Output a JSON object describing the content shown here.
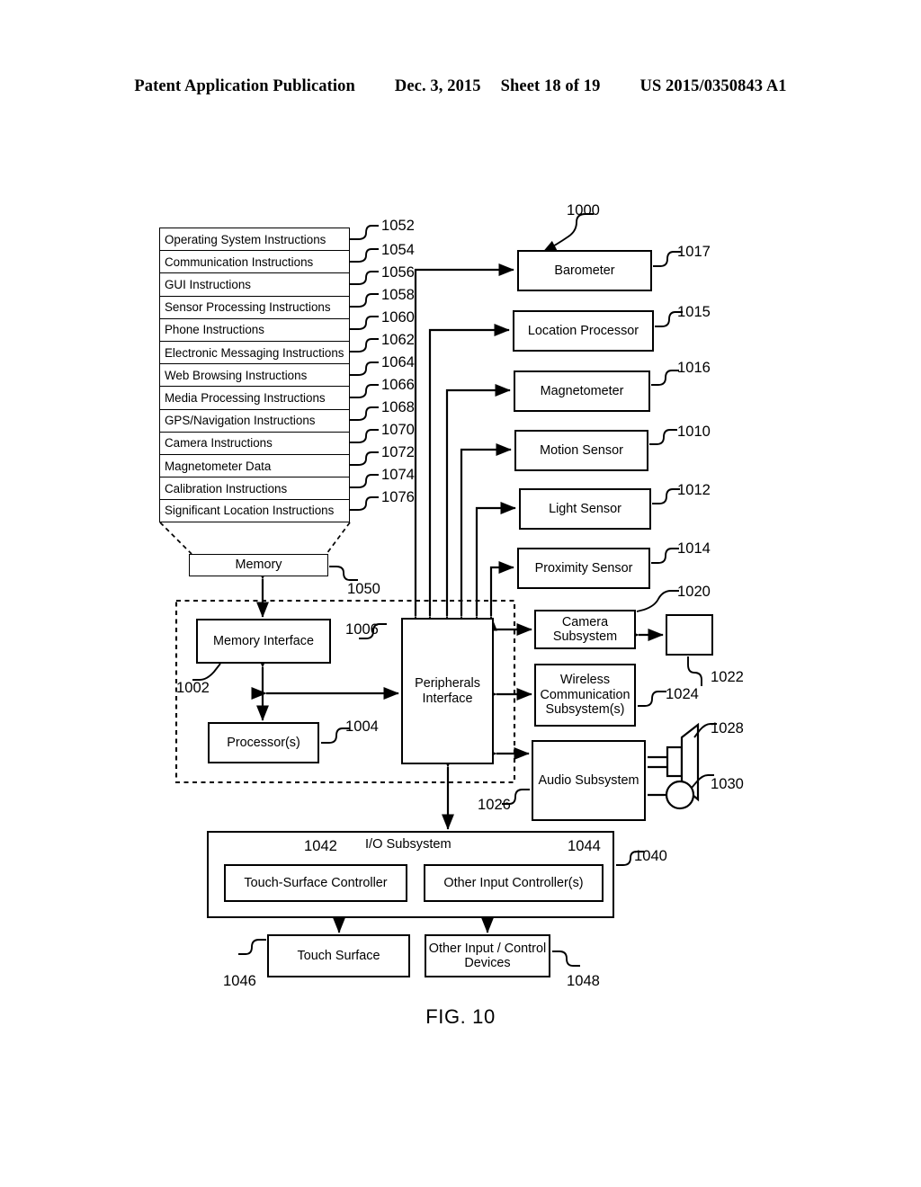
{
  "header": {
    "publication": "Patent Application Publication",
    "date": "Dec. 3, 2015",
    "sheet": "Sheet 18 of 19",
    "patent_number": "US 2015/0350843 A1"
  },
  "figure": {
    "caption": "FIG. 10",
    "system_ref": "1000"
  },
  "memory": {
    "label": "Memory",
    "ref": "1050",
    "instructions": [
      {
        "label": "Operating System Instructions",
        "ref": "1052"
      },
      {
        "label": "Communication Instructions",
        "ref": "1054"
      },
      {
        "label": "GUI Instructions",
        "ref": "1056"
      },
      {
        "label": "Sensor Processing Instructions",
        "ref": "1058"
      },
      {
        "label": "Phone Instructions",
        "ref": "1060"
      },
      {
        "label": "Electronic Messaging Instructions",
        "ref": "1062"
      },
      {
        "label": "Web Browsing Instructions",
        "ref": "1064"
      },
      {
        "label": "Media Processing Instructions",
        "ref": "1066"
      },
      {
        "label": "GPS/Navigation Instructions",
        "ref": "1068"
      },
      {
        "label": "Camera Instructions",
        "ref": "1070"
      },
      {
        "label": "Magnetometer Data",
        "ref": "1072"
      },
      {
        "label": "Calibration Instructions",
        "ref": "1074"
      },
      {
        "label": "Significant Location Instructions",
        "ref": "1076"
      }
    ]
  },
  "core": {
    "memory_interface": {
      "label": "Memory Interface",
      "ref": "1002"
    },
    "processors": {
      "label": "Processor(s)",
      "ref": "1004"
    },
    "peripherals_interface": {
      "label_line1": "Peripherals",
      "label_line2": "Interface",
      "ref": "1006"
    }
  },
  "sensors": [
    {
      "label": "Barometer",
      "ref": "1017"
    },
    {
      "label": "Location Processor",
      "ref": "1015"
    },
    {
      "label": "Magnetometer",
      "ref": "1016"
    },
    {
      "label": "Motion Sensor",
      "ref": "1010"
    },
    {
      "label": "Light Sensor",
      "ref": "1012"
    },
    {
      "label": "Proximity Sensor",
      "ref": "1014"
    }
  ],
  "subsystems": {
    "camera": {
      "label_line1": "Camera",
      "label_line2": "Subsystem",
      "ref": "1020"
    },
    "optical_sensor": {
      "label": "",
      "ref": "1022"
    },
    "wireless": {
      "label_line1": "Wireless",
      "label_line2": "Communication",
      "label_line3": "Subsystem(s)",
      "ref": "1024"
    },
    "audio": {
      "label": "Audio Subsystem",
      "ref": "1026"
    },
    "speaker": {
      "ref": "1028"
    },
    "microphone": {
      "ref": "1030"
    }
  },
  "io_subsystem": {
    "title": "I/O Subsystem",
    "ref": "1040",
    "touch_controller": {
      "label": "Touch-Surface Controller",
      "ref": "1042"
    },
    "other_controller": {
      "label": "Other Input Controller(s)",
      "ref": "1044"
    },
    "touch_surface": {
      "label": "Touch Surface",
      "ref": "1046"
    },
    "other_devices": {
      "label_line1": "Other Input / Control",
      "label_line2": "Devices",
      "ref": "1048"
    }
  }
}
